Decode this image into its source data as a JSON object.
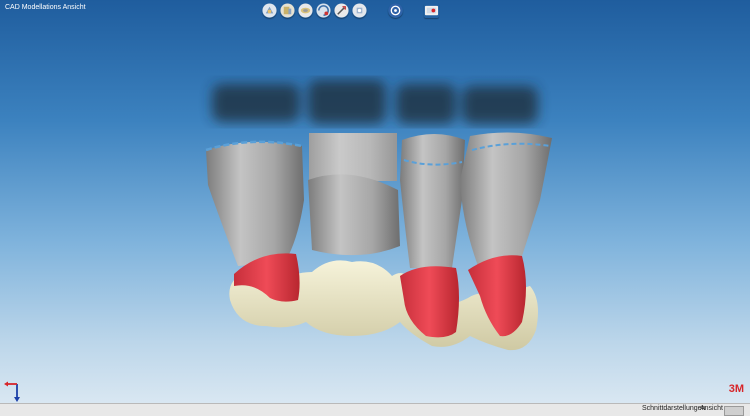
{
  "window": {
    "title": "CAD Modellations Ansicht"
  },
  "toolbar": {
    "icons": [
      "view-front-icon",
      "view-side-icon",
      "view-top-icon",
      "view-rotate-icon",
      "tools-icon",
      "view-back-icon",
      "info-icon",
      "screenshot-icon"
    ]
  },
  "brand": {
    "logo": "3M"
  },
  "statusbar": {
    "section_settings": "Schnittdarstellungen",
    "view": "Ansicht"
  },
  "colors": {
    "background_top": "#1f5d9e",
    "background_bottom": "#d9e7f2",
    "tooth_gray": "#a9a9a9",
    "margin_red": "#e03a47",
    "crown_ivory": "#ece8c8",
    "logo_red": "#d7262a"
  }
}
